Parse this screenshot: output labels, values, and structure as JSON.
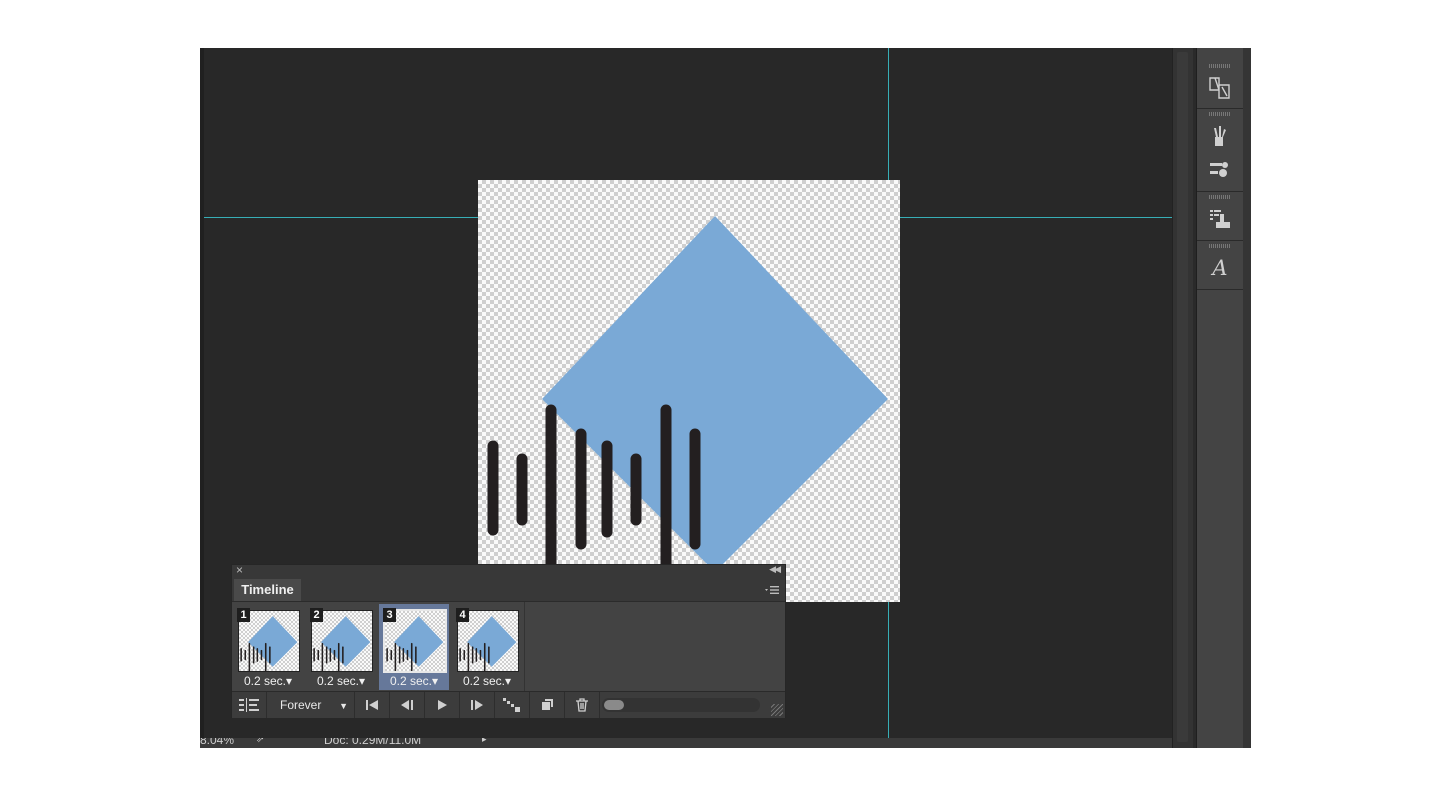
{
  "colors": {
    "shape_fill": "#7aa9d6",
    "bar_fill": "#231f20",
    "guide": "#39c5cf",
    "selected_frame": "#66789a"
  },
  "right_panel": {
    "icons": [
      "paragraph-styles-icon",
      "brush-presets-icon",
      "clone-source-icon",
      "actions-icon",
      "glyph-icon"
    ],
    "glyph_letter": "A"
  },
  "timeline": {
    "tab_label": "Timeline",
    "close_glyph": "×",
    "collapse_glyph": "◀◀",
    "frames": [
      {
        "number": "1",
        "delay": "0.2 sec.▾",
        "selected": false
      },
      {
        "number": "2",
        "delay": "0.2 sec.▾",
        "selected": false
      },
      {
        "number": "3",
        "delay": "0.2 sec.▾",
        "selected": true
      },
      {
        "number": "4",
        "delay": "0.2 sec.▾",
        "selected": false
      }
    ],
    "loop_option": "Forever",
    "loop_arrow": "▼"
  },
  "status_bar": {
    "zoom": "8.04%",
    "doc_info": "Doc: 0.29M/11.0M"
  }
}
